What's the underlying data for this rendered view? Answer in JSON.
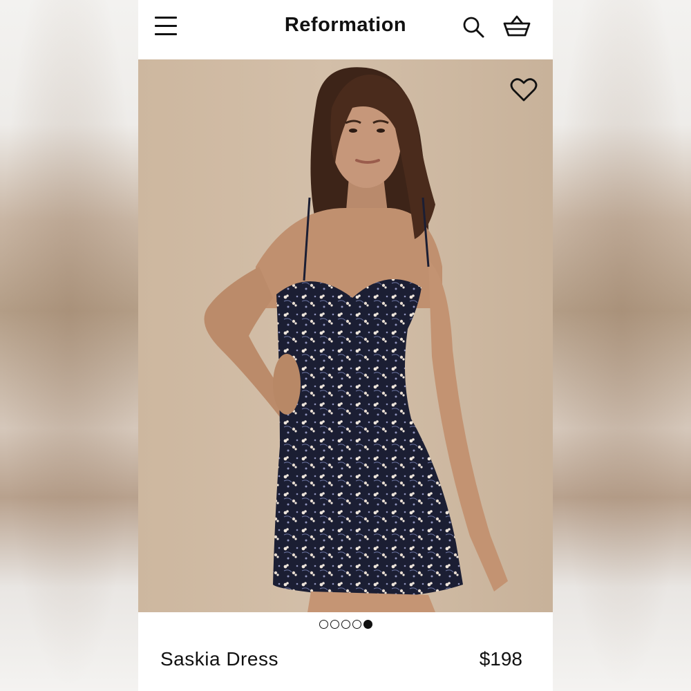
{
  "header": {
    "brand": "Reformation",
    "icons": {
      "menu": "hamburger-menu-icon",
      "search": "search-icon",
      "cart": "shopping-basket-icon"
    }
  },
  "gallery": {
    "image_subject": "model wearing navy floral mini dress",
    "favorite_icon": "heart-icon",
    "total_images": 5,
    "active_index": 5
  },
  "product": {
    "name": "Saskia Dress",
    "price": "$198"
  },
  "colors": {
    "text": "#111111",
    "background": "#ffffff",
    "photo_backdrop": "#cdb79f"
  }
}
